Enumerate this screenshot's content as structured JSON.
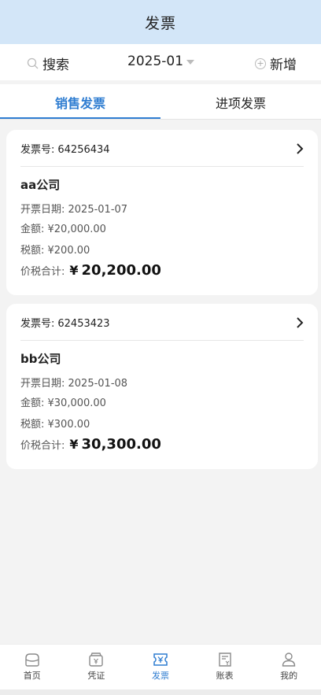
{
  "header": {
    "title": "发票"
  },
  "toolbar": {
    "search_label": "搜索",
    "month_value": "2025-01",
    "add_label": "新增"
  },
  "tabs": [
    {
      "label": "销售发票",
      "active": true
    },
    {
      "label": "进项发票",
      "active": false
    }
  ],
  "invoices": [
    {
      "number_label": "发票号:",
      "number": "64256434",
      "company": "aa公司",
      "date_line": "开票日期:  2025-01-07",
      "amount_line": "金额:  ¥20,000.00",
      "tax_line": "税额:  ¥200.00",
      "total_label": "价税合计:",
      "total_currency": "¥",
      "total_amount": "20,200.00"
    },
    {
      "number_label": "发票号:",
      "number": "62453423",
      "company": "bb公司",
      "date_line": "开票日期:  2025-01-08",
      "amount_line": "金额:  ¥30,000.00",
      "tax_line": "税额:  ¥300.00",
      "total_label": "价税合计:",
      "total_currency": "¥",
      "total_amount": "30,300.00"
    }
  ],
  "tabbar": {
    "items": [
      {
        "label": "首页",
        "icon": "home-icon",
        "active": false
      },
      {
        "label": "凭证",
        "icon": "voucher-icon",
        "active": false
      },
      {
        "label": "发票",
        "icon": "invoice-icon",
        "active": true
      },
      {
        "label": "账表",
        "icon": "ledger-icon",
        "active": false
      },
      {
        "label": "我的",
        "icon": "profile-icon",
        "active": false
      }
    ],
    "active_color": "#2f7dd1",
    "inactive_color": "#8a8a8a"
  },
  "colors": {
    "header_bg": "#d3e6f8",
    "accent": "#2f7dd1"
  }
}
